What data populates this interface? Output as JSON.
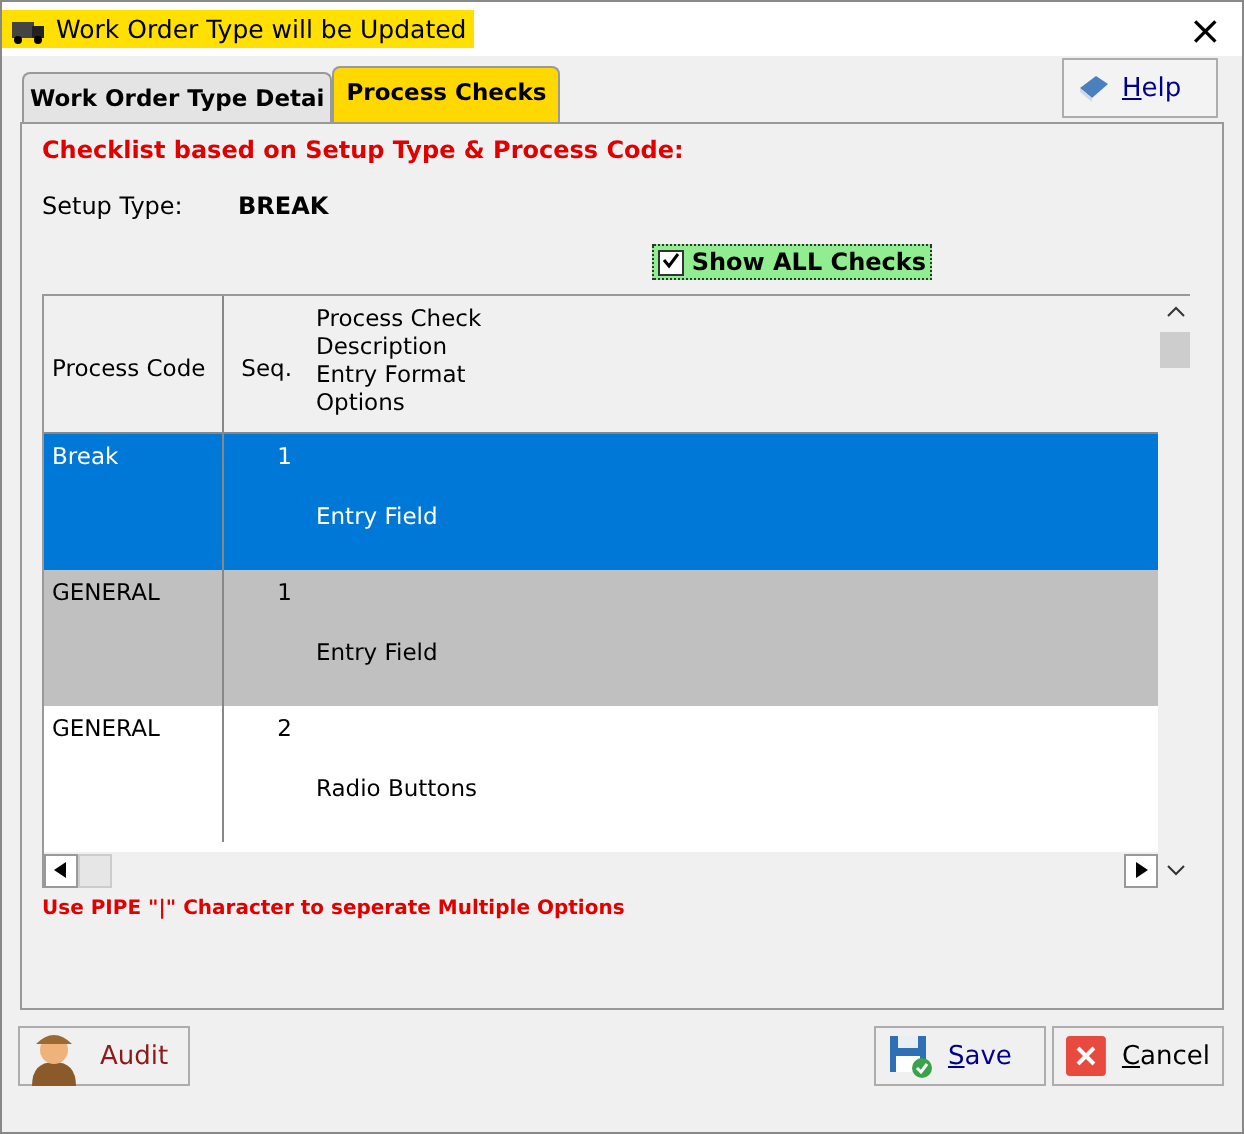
{
  "window": {
    "title": "Work Order Type will be Updated",
    "close": "×"
  },
  "tabs": [
    {
      "label": "Work Order Type Detai",
      "selected": false
    },
    {
      "label": "Process Checks",
      "selected": true
    }
  ],
  "help_button": "Help",
  "heading": "Checklist based on Setup Type & Process Code:",
  "setup_type": {
    "label": "Setup Type:",
    "value": "BREAK"
  },
  "show_all": {
    "label": "Show ALL Checks",
    "checked": true
  },
  "table": {
    "columns": [
      "Process Code",
      "Seq.",
      [
        "Process Check",
        "Description",
        "Entry Format",
        "Options"
      ]
    ],
    "rows": [
      {
        "code": "Break",
        "seq": "1",
        "format": "Entry Field",
        "selected": true,
        "shaded": false
      },
      {
        "code": "GENERAL",
        "seq": "1",
        "format": "Entry Field",
        "selected": false,
        "shaded": true
      },
      {
        "code": "GENERAL",
        "seq": "2",
        "format": "Radio Buttons",
        "selected": false,
        "shaded": false
      }
    ]
  },
  "hint": "Use PIPE \"|\" Character to seperate Multiple Options",
  "buttons": {
    "audit": "Audit",
    "save": "Save",
    "cancel": "Cancel"
  }
}
